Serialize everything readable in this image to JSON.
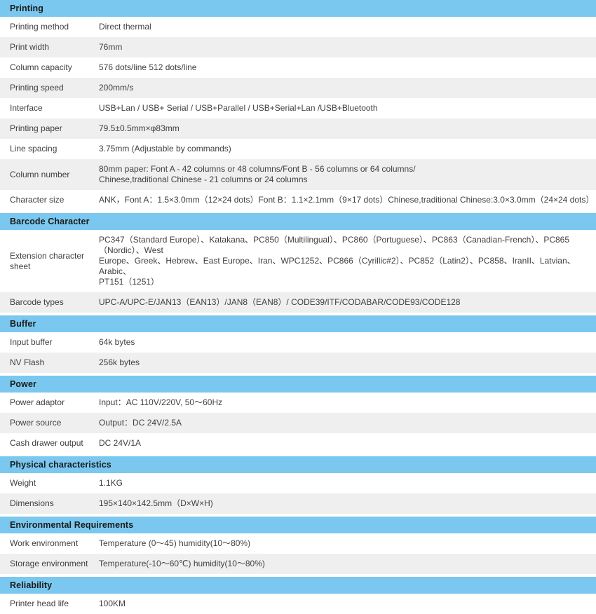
{
  "document": {
    "title": "Printer Specification Table",
    "accent_color": "#7ac8ef",
    "row_alt_color": "#efeff0",
    "text_color": "#3f3f3f"
  },
  "sections": [
    {
      "heading": "Printing",
      "rows": [
        {
          "label": "Printing method",
          "value": "Direct thermal"
        },
        {
          "label": "Print width",
          "value": "76mm"
        },
        {
          "label": "Column capacity",
          "value": "576 dots/line 512 dots/line"
        },
        {
          "label": "Printing speed",
          "value": "200mm/s"
        },
        {
          "label": "Interface",
          "value": "USB+Lan / USB+ Serial / USB+Parallel / USB+Serial+Lan /USB+Bluetooth"
        },
        {
          "label": "Printing paper",
          "value": "79.5±0.5mm×φ83mm"
        },
        {
          "label": "Line spacing",
          "value": "3.75mm (Adjustable by commands)"
        },
        {
          "label": "Column number",
          "value": "80mm paper: Font A - 42 columns or 48 columns/Font B - 56 columns or 64 columns/\nChinese,traditional Chinese - 21 columns or 24 columns"
        },
        {
          "label": "Character size",
          "value": "ANK，Font A：1.5×3.0mm（12×24 dots）Font B：1.1×2.1mm（9×17 dots）Chinese,traditional Chinese:3.0×3.0mm（24×24 dots）"
        }
      ]
    },
    {
      "heading": "Barcode Character",
      "rows": [
        {
          "label": "Extension character sheet",
          "value": "PC347（Standard Europe）、Katakana、PC850（Multilingual）、PC860（Portuguese）、PC863（Canadian-French）、PC865（Nordic）、West\nEurope、Greek、Hebrew、East Europe、Iran、WPC1252、PC866（Cyrillic#2）、PC852（Latin2）、PC858、IranII、Latvian、Arabic、\nPT151（1251）"
        },
        {
          "label": "Barcode types",
          "value": "UPC-A/UPC-E/JAN13（EAN13）/JAN8（EAN8）/ CODE39/ITF/CODABAR/CODE93/CODE128"
        }
      ]
    },
    {
      "heading": "Buffer",
      "rows": [
        {
          "label": "Input buffer",
          "value": "64k bytes"
        },
        {
          "label": "NV Flash",
          "value": "256k bytes"
        }
      ]
    },
    {
      "heading": "Power",
      "rows": [
        {
          "label": "Power adaptor",
          "value": "Input：AC 110V/220V, 50～60Hz"
        },
        {
          "label": "Power source",
          "value": "Output：DC 24V/2.5A"
        },
        {
          "label": "Cash drawer output",
          "value": "DC 24V/1A"
        }
      ]
    },
    {
      "heading": "Physical characteristics",
      "rows": [
        {
          "label": "Weight",
          "value": "1.1KG"
        },
        {
          "label": "Dimensions",
          "value": "195×140×142.5mm（D×W×H)"
        }
      ]
    },
    {
      "heading": "Environmental Requirements",
      "rows": [
        {
          "label": "Work environment",
          "value": "Temperature (0～45) humidity(10～80%)"
        },
        {
          "label": "Storage environment",
          "value": "Temperature(-10～60℃) humidity(10～80%)"
        }
      ]
    },
    {
      "heading": "Reliability",
      "rows": [
        {
          "label": "Printer head life",
          "value": "100KM"
        }
      ]
    }
  ]
}
